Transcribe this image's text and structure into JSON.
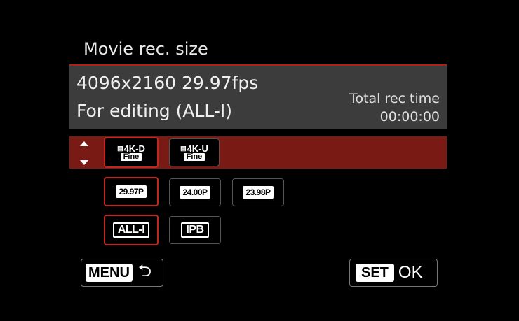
{
  "title": "Movie rec. size",
  "info": {
    "size_line": "4096x2160 29.97fps",
    "mode_line": "For editing (ALL-I)",
    "total_label": "Total rec time",
    "total_value": "00:00:00"
  },
  "resolution_options": [
    {
      "code": "4K-D",
      "sub": "Fine",
      "selected": true
    },
    {
      "code": "4K-U",
      "sub": "Fine",
      "selected": false
    }
  ],
  "frame_rate_options": [
    {
      "label": "29.97P",
      "selected": true
    },
    {
      "label": "24.00P",
      "selected": false
    },
    {
      "label": "23.98P",
      "selected": false
    }
  ],
  "compression_options": [
    {
      "label": "ALL-I",
      "selected": true
    },
    {
      "label": "IPB",
      "selected": false
    }
  ],
  "footer": {
    "menu_key": "MENU",
    "set_key": "SET",
    "ok_label": "OK"
  },
  "colors": {
    "accent_red": "#c0281f",
    "selected_row": "#7a1a15",
    "info_bg": "#3c3c3c"
  }
}
